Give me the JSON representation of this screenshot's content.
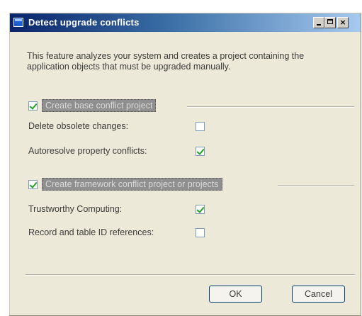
{
  "window": {
    "title": "Detect upgrade conflicts"
  },
  "description": "This feature analyzes your system and creates a project containing the application objects that must be upgraded manually.",
  "group1": {
    "label": "Create base conflict project",
    "checked": true,
    "options": [
      {
        "label": "Delete obsolete changes:",
        "checked": false
      },
      {
        "label": "Autoresolve property conflicts:",
        "checked": true
      }
    ]
  },
  "group2": {
    "label": "Create framework conflict project or projects",
    "checked": true,
    "options": [
      {
        "label": "Trustworthy Computing:",
        "checked": true
      },
      {
        "label": "Record and table ID references:",
        "checked": false
      }
    ]
  },
  "buttons": {
    "ok": "OK",
    "cancel": "Cancel"
  },
  "colors": {
    "title_start": "#0a246a",
    "title_end": "#a6caf0",
    "dialog_bg": "#ece9d8",
    "check_green": "#21a121"
  }
}
